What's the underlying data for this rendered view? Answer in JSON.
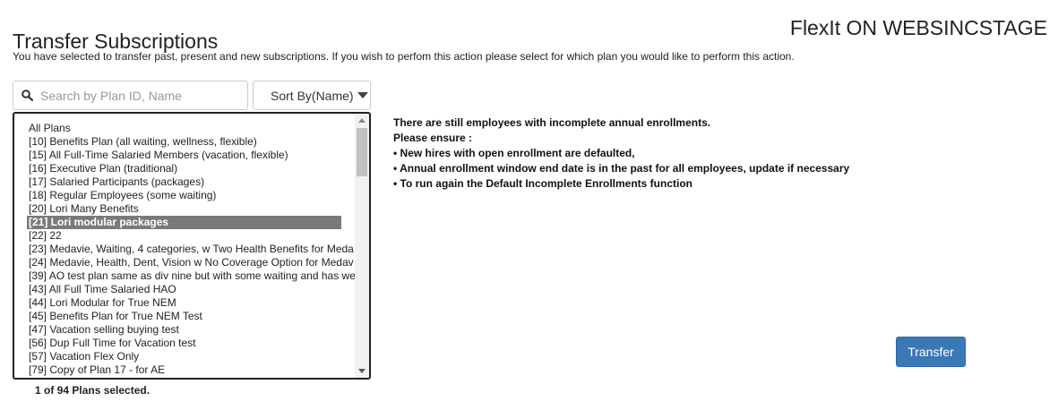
{
  "header": {
    "title": "Transfer Subscriptions",
    "environment": "FlexIt ON WEBSINCSTAGE",
    "description": "You have selected to transfer past, present and new subscriptions. If you wish to perfom this action please select for which plan you would like to perform this action."
  },
  "search": {
    "placeholder": "Search by Plan ID, Name",
    "value": "",
    "icon": "search-icon"
  },
  "sort": {
    "label": "Sort By(Name)",
    "icon": "caret-down-icon"
  },
  "plans": {
    "selected_index": 7,
    "items": [
      "All Plans",
      "[10] Benefits Plan (all waiting, wellness, flexible)",
      "[15] All Full-Time Salaried Members (vacation, flexible)",
      "[16] Executive Plan (traditional)",
      "[17] Salaried Participants (packages)",
      "[18] Regular Employees (some waiting)",
      "[20] Lori Many Benefits",
      "[21] Lori modular packages",
      "[22] 22",
      "[23] Medavie, Waiting, 4 categories, w Two Health Benefits for Meda",
      "[24] Medavie, Health, Dent, Vision w No Coverage Option for Medav",
      "[39] AO test plan same as div nine but with some waiting and has we",
      "[43] All Full Time Salaried HAO",
      "[44] Lori Modular for True NEM",
      "[45] Benefits Plan for True NEM Test",
      "[47] Vacation selling buying test",
      "[56] Dup Full Time for Vacation test",
      "[57] Vacation Flex Only",
      "[79] Copy of Plan 17 - for AE"
    ],
    "selection_summary": "1 of 94 Plans selected."
  },
  "notice": {
    "lines": [
      "There are still employees with incomplete annual enrollments.",
      "Please ensure :",
      "• New hires with open enrollment are defaulted,",
      "• Annual enrollment window end date is in the past for all employees, update if necessary",
      "• To run again the Default Incomplete Enrollments function"
    ]
  },
  "actions": {
    "transfer_label": "Transfer"
  },
  "colors": {
    "primary_button": "#3a78b6",
    "selected_row": "#7a7a7a"
  }
}
